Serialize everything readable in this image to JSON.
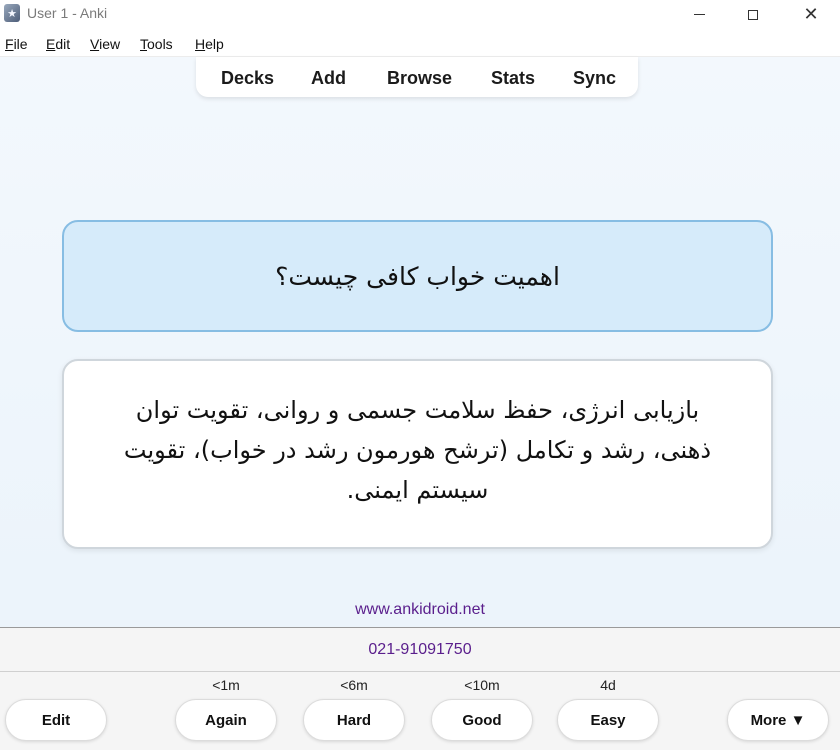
{
  "window": {
    "title": "User 1 - Anki",
    "app_icon_glyph": "★",
    "minimize_icon": "minimize-icon",
    "maximize_icon": "maximize-icon",
    "close_glyph": "✕"
  },
  "menu": {
    "file": {
      "accel": "F",
      "rest": "ile"
    },
    "edit": {
      "accel": "E",
      "rest": "dit"
    },
    "view": {
      "accel": "V",
      "rest": "iew"
    },
    "tools": {
      "accel": "T",
      "rest": "ools"
    },
    "help": {
      "accel": "H",
      "rest": "elp"
    }
  },
  "nav": {
    "decks": "Decks",
    "add": "Add",
    "browse": "Browse",
    "stats": "Stats",
    "sync": "Sync"
  },
  "card": {
    "question": "اهمیت خواب کافی چیست؟",
    "answer": "بازیابی انرژی، حفظ سلامت جسمی و روانی، تقویت توان ذهنی، رشد و تکامل (ترشح هورمون رشد در خواب)، تقویت سیستم ایمنی."
  },
  "footer": {
    "website": "www.ankidroid.net",
    "phone": "021-91091750"
  },
  "review": {
    "edit_label": "Edit",
    "more_label": "More ▼",
    "buttons": [
      {
        "label": "Again",
        "interval": "<1m"
      },
      {
        "label": "Hard",
        "interval": "<6m"
      },
      {
        "label": "Good",
        "interval": "<10m"
      },
      {
        "label": "Easy",
        "interval": "4d"
      }
    ]
  },
  "colors": {
    "question_bg": "#d6ebfa",
    "question_border": "#87bde3",
    "link_color": "#5a1e8c"
  }
}
